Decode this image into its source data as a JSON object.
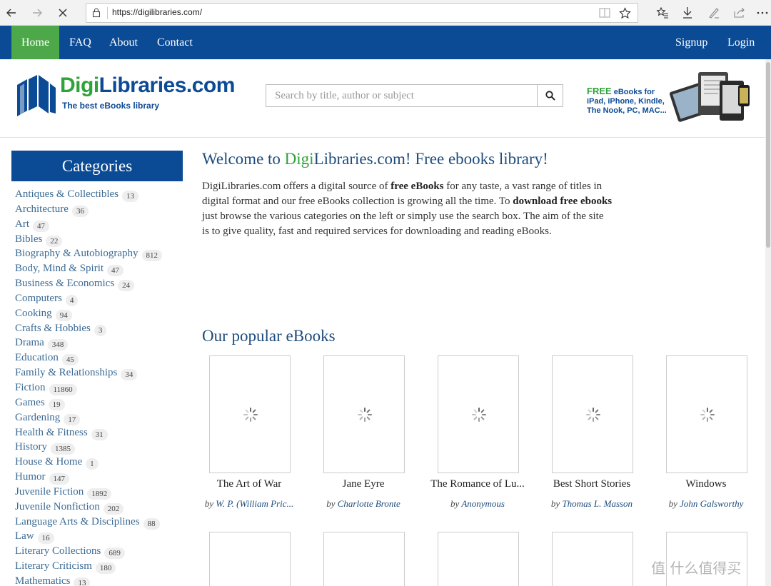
{
  "browser": {
    "url": "https://digilibraries.com/"
  },
  "topnav": {
    "home": "Home",
    "faq": "FAQ",
    "about": "About",
    "contact": "Contact",
    "signup": "Signup",
    "login": "Login"
  },
  "header": {
    "logo_part1": "Digi",
    "logo_part2": "Libraries.com",
    "tagline": "The best eBooks library",
    "search_placeholder": "Search by title, author or subject",
    "promo_free": "FREE",
    "promo_line1": " eBooks for",
    "promo_line2": "iPad, iPhone, Kindle,",
    "promo_line3": "The Nook, PC, MAC..."
  },
  "sidebar": {
    "title": "Categories",
    "items": [
      {
        "label": "Antiques & Collectibles",
        "count": "13"
      },
      {
        "label": "Architecture",
        "count": "36"
      },
      {
        "label": "Art",
        "count": "47"
      },
      {
        "label": "Bibles",
        "count": "22"
      },
      {
        "label": "Biography & Autobiography",
        "count": "812"
      },
      {
        "label": "Body, Mind & Spirit",
        "count": "47"
      },
      {
        "label": "Business & Economics",
        "count": "24"
      },
      {
        "label": "Computers",
        "count": "4"
      },
      {
        "label": "Cooking",
        "count": "94"
      },
      {
        "label": "Crafts & Hobbies",
        "count": "3"
      },
      {
        "label": "Drama",
        "count": "348"
      },
      {
        "label": "Education",
        "count": "45"
      },
      {
        "label": "Family & Relationships",
        "count": "34"
      },
      {
        "label": "Fiction",
        "count": "11860"
      },
      {
        "label": "Games",
        "count": "19"
      },
      {
        "label": "Gardening",
        "count": "17"
      },
      {
        "label": "Health & Fitness",
        "count": "31"
      },
      {
        "label": "History",
        "count": "1385"
      },
      {
        "label": "House & Home",
        "count": "1"
      },
      {
        "label": "Humor",
        "count": "147"
      },
      {
        "label": "Juvenile Fiction",
        "count": "1892"
      },
      {
        "label": "Juvenile Nonfiction",
        "count": "202"
      },
      {
        "label": "Language Arts & Disciplines",
        "count": "88"
      },
      {
        "label": "Law",
        "count": "16"
      },
      {
        "label": "Literary Collections",
        "count": "689"
      },
      {
        "label": "Literary Criticism",
        "count": "180"
      },
      {
        "label": "Mathematics",
        "count": "13"
      }
    ]
  },
  "main": {
    "welcome_prefix": "Welcome to ",
    "welcome_digi": "Digi",
    "welcome_suffix": "Libraries.com! Free ebooks library!",
    "intro_1": "DigiLibraries.com offers a digital source of ",
    "intro_bold1": "free eBooks",
    "intro_2": " for any taste, a vast range of titles in digital format and our free eBooks collection is growing all the time. To ",
    "intro_bold2": "download free ebooks",
    "intro_3": " just browse the various categories on the left or simply use the search box. The aim of the site is to give quality, fast and required services for downloading and reading eBooks.",
    "popular_title": "Our popular eBooks",
    "by": "by ",
    "books": [
      {
        "title": "The Art of War",
        "author": "W. P. (William Pric..."
      },
      {
        "title": "Jane Eyre",
        "author": "Charlotte Bronte"
      },
      {
        "title": "The Romance of Lu...",
        "author": "Anonymous"
      },
      {
        "title": "Best Short Stories",
        "author": "Thomas L. Masson"
      },
      {
        "title": "Windows",
        "author": "John Galsworthy"
      }
    ]
  },
  "watermark": "值 什么值得买"
}
